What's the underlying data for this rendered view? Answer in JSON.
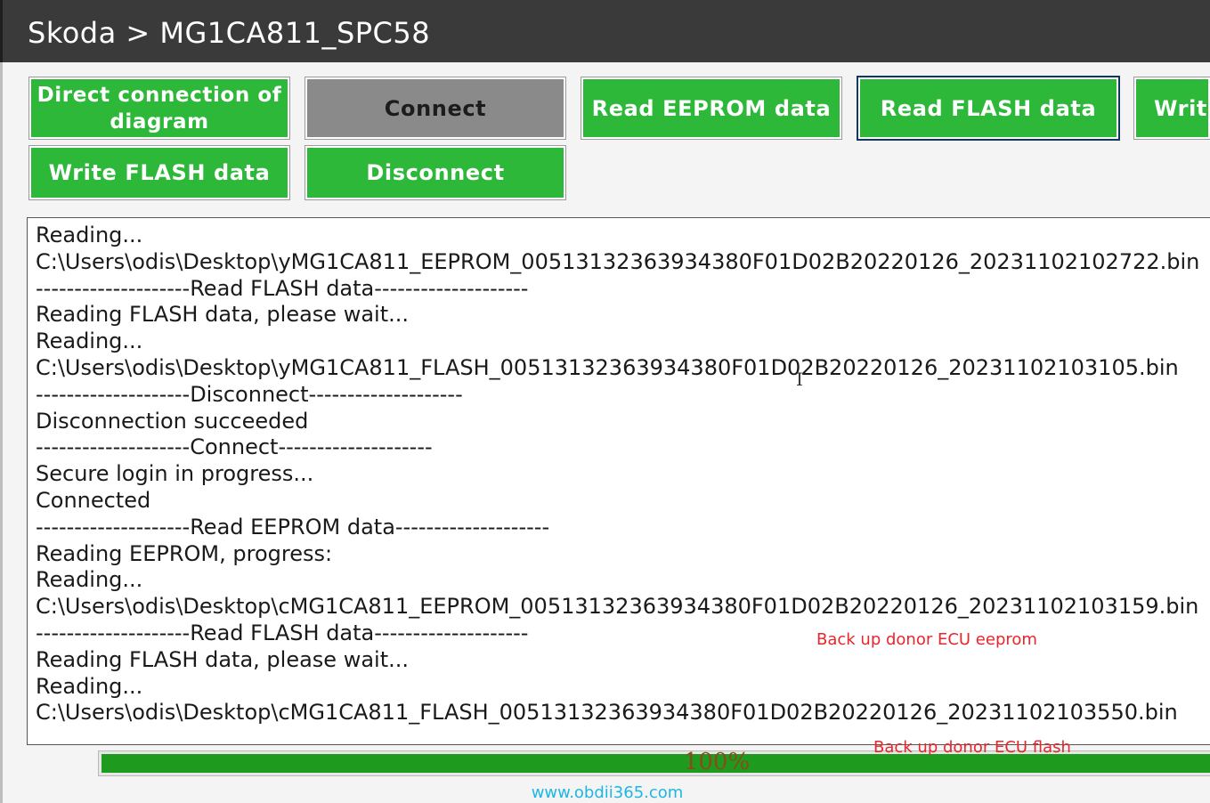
{
  "window": {
    "breadcrumb": "Skoda > MG1CA811_SPC58"
  },
  "buttons": {
    "direct_connection": "Direct connection of diagram",
    "connect": "Connect",
    "read_eeprom": "Read EEPROM data",
    "read_flash": "Read FLASH data",
    "write_partial": "Write",
    "write_flash": "Write FLASH data",
    "disconnect": "Disconnect"
  },
  "log": {
    "lines": [
      "Reading...",
      "C:\\Users\\odis\\Desktop\\yMG1CA811_EEPROM_00513132363934380F01D02B20220126_20231102102722.bin",
      "--------------------Read FLASH data--------------------",
      "Reading FLASH data, please wait...",
      "Reading...",
      "C:\\Users\\odis\\Desktop\\yMG1CA811_FLASH_00513132363934380F01D02B20220126_20231102103105.bin",
      "--------------------Disconnect--------------------",
      "Disconnection succeeded",
      "--------------------Connect--------------------",
      "Secure login in progress...",
      "Connected",
      "--------------------Read EEPROM data--------------------",
      "Reading EEPROM, progress:",
      "Reading...",
      "C:\\Users\\odis\\Desktop\\cMG1CA811_EEPROM_00513132363934380F01D02B20220126_20231102103159.bin",
      "--------------------Read FLASH data--------------------",
      "Reading FLASH data, please wait...",
      "Reading...",
      "C:\\Users\\odis\\Desktop\\cMG1CA811_FLASH_00513132363934380F01D02B20220126_20231102103550.bin"
    ]
  },
  "annotations": {
    "eeprom_note": "Back up donor ECU eeprom",
    "flash_note": "Back up donor ECU flash"
  },
  "progress": {
    "label": "100%",
    "value": 100
  },
  "watermark": "www.obdii365.com",
  "colors": {
    "button_green": "#2db83a",
    "button_disabled": "#8a8a8a",
    "progress_green": "#1e9b1e",
    "annotation_red": "#e8262b",
    "watermark_blue": "#1fb6e3"
  }
}
